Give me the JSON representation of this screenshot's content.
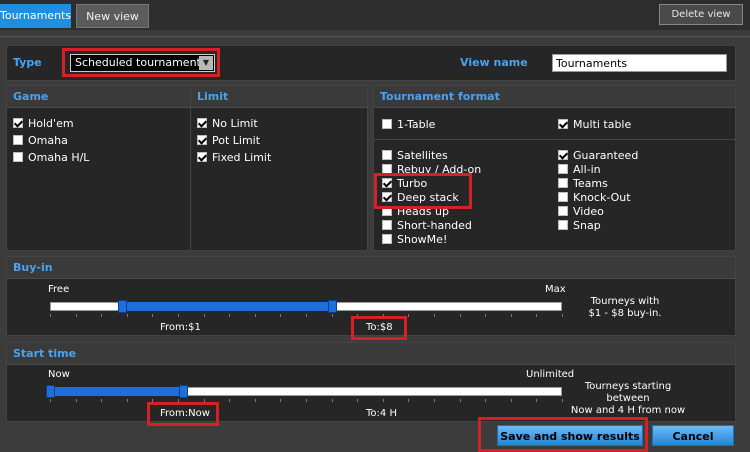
{
  "tabs": {
    "active": "Tournaments",
    "inactive": "New view",
    "delete": "Delete view"
  },
  "type": {
    "label": "Type",
    "selected": "Scheduled tournaments",
    "arrow": "▼"
  },
  "viewname": {
    "label": "View name",
    "value": "Tournaments"
  },
  "game": {
    "title": "Game",
    "items": [
      {
        "label": "Hold'em",
        "checked": true
      },
      {
        "label": "Omaha",
        "checked": false
      },
      {
        "label": "Omaha H/L",
        "checked": false
      }
    ]
  },
  "limit": {
    "title": "Limit",
    "items": [
      {
        "label": "No Limit",
        "checked": true
      },
      {
        "label": "Pot Limit",
        "checked": true
      },
      {
        "label": "Fixed Limit",
        "checked": true
      }
    ]
  },
  "format": {
    "title": "Tournament format",
    "one_table": {
      "label": "1-Table",
      "checked": false
    },
    "multi_table": {
      "label": "Multi table",
      "checked": true
    },
    "left": [
      {
        "label": "Satellites",
        "checked": false
      },
      {
        "label": "Rebuy / Add-on",
        "checked": false
      },
      {
        "label": "Turbo",
        "checked": true
      },
      {
        "label": "Deep stack",
        "checked": true
      },
      {
        "label": "Heads up",
        "checked": false
      },
      {
        "label": "Short-handed",
        "checked": false
      },
      {
        "label": "ShowMe!",
        "checked": false
      }
    ],
    "right": [
      {
        "label": "Guaranteed",
        "checked": true
      },
      {
        "label": "All-in",
        "checked": false
      },
      {
        "label": "Teams",
        "checked": false
      },
      {
        "label": "Knock-Out",
        "checked": false
      },
      {
        "label": "Video",
        "checked": false
      },
      {
        "label": "Snap",
        "checked": false
      }
    ]
  },
  "buyin": {
    "title": "Buy-in",
    "min_label": "Free",
    "max_label": "Max",
    "from": "From:$1",
    "to": "To:$8",
    "range_fraction": [
      0.14,
      0.55
    ],
    "desc_line1": "Tourneys with",
    "desc_line2": "$1 - $8 buy-in."
  },
  "start": {
    "title": "Start time",
    "min_label": "Now",
    "max_label": "Unlimited",
    "from": "From:Now",
    "to": "To:4 H",
    "range_fraction": [
      0.0,
      0.26
    ],
    "desc_line1": "Tourneys starting  between",
    "desc_line2": "Now and 4 H from now"
  },
  "buttons": {
    "save": "Save and show results",
    "cancel": "Cancel"
  },
  "colors": {
    "accent": "#1d8ee0",
    "highlight": "#d42027",
    "panel": "#262626"
  },
  "icons": {
    "dropdown": "chevron-down-icon",
    "check": "check-icon"
  }
}
